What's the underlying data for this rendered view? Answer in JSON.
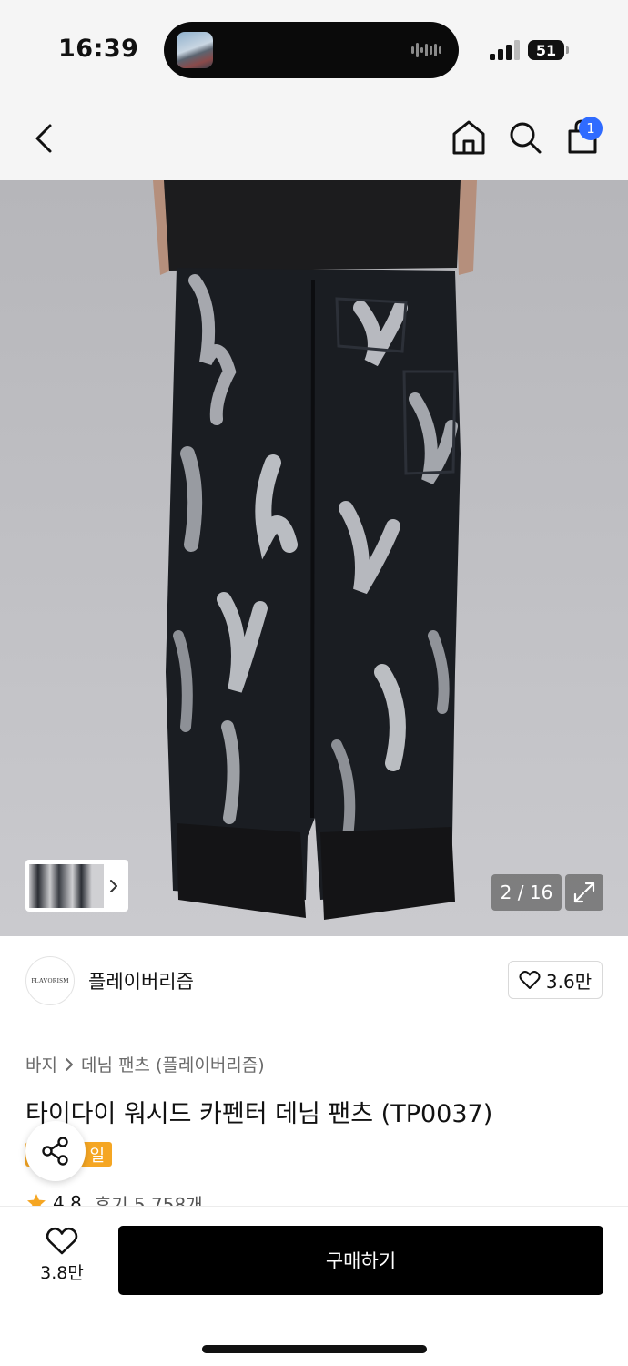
{
  "status_bar": {
    "time": "16:39",
    "battery": "51"
  },
  "nav": {
    "cart_count": "1",
    "icons": [
      "back-chevron-icon",
      "home-icon",
      "search-icon",
      "shopping-bag-icon"
    ]
  },
  "gallery": {
    "counter": "2 / 16",
    "current_index": 2,
    "total": 16
  },
  "brand": {
    "logo_text": "FLAVORISM",
    "name": "플레이버리즘",
    "likes": "3.6만"
  },
  "product": {
    "breadcrumb": [
      "바지",
      "데님 팬츠 (플레이버리즘)"
    ],
    "title": "타이다이 워시드 카펜터 데님 팬츠 (TP0037)",
    "badge": "일",
    "rating": "4.8",
    "reviews": "후기 5,758개"
  },
  "bottom_bar": {
    "likes": "3.8만",
    "buy_label": "구매하기"
  },
  "colors": {
    "accent_blue": "#2f6bff",
    "sale_orange": "#f5a623",
    "star": "#f5a623",
    "buy_button": "#000000"
  }
}
